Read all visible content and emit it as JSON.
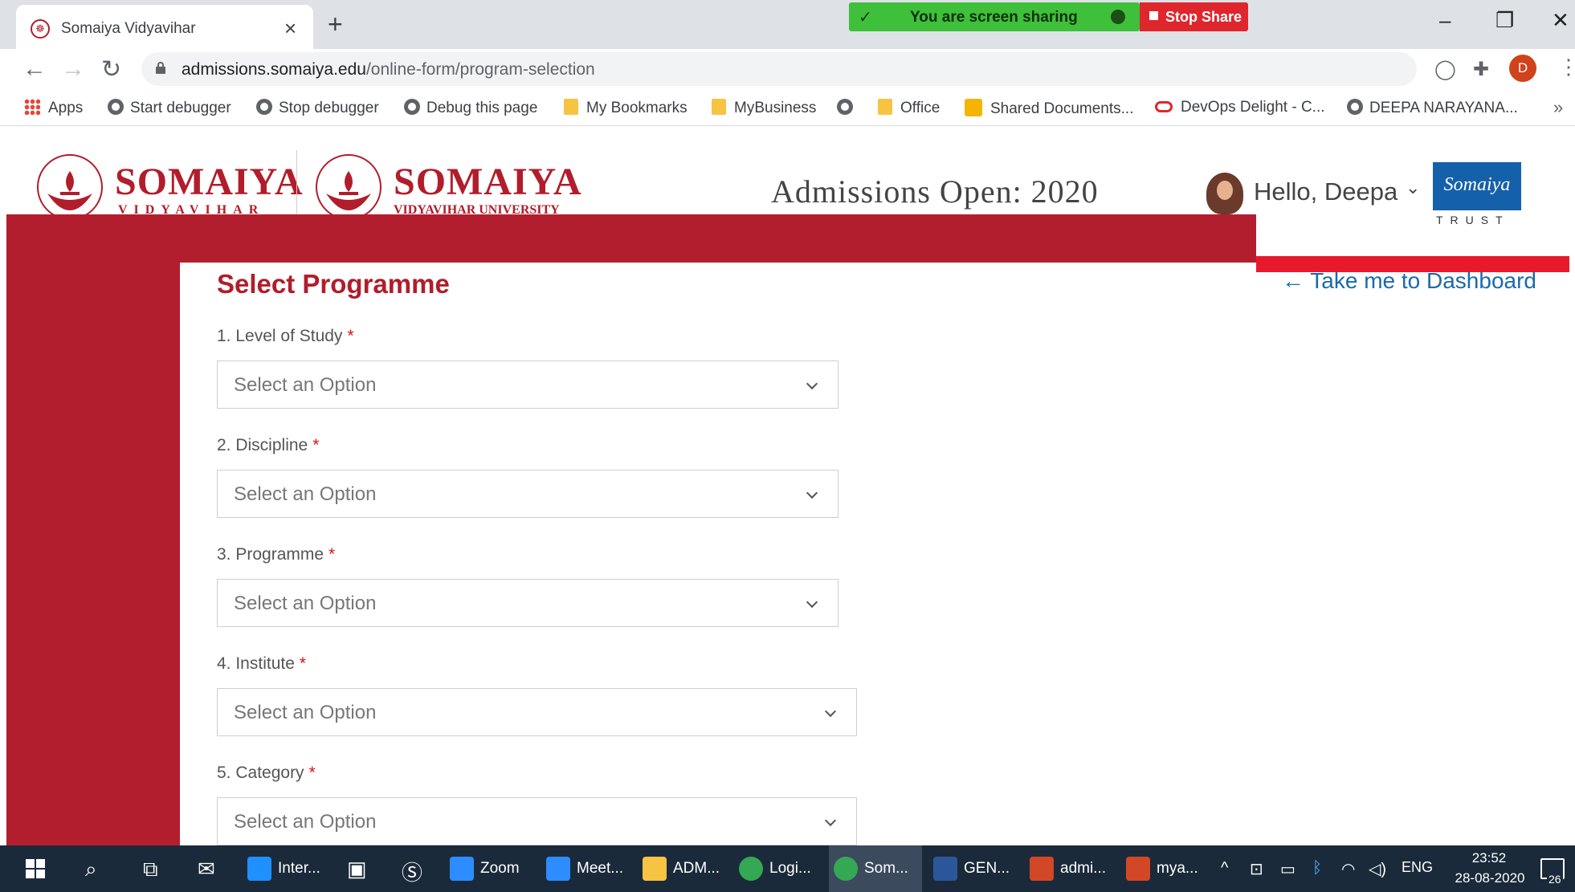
{
  "browser": {
    "tab_title": "Somaiya Vidyavihar",
    "url_host": "admissions.somaiya.edu",
    "url_path": "/online-form/program-selection",
    "profile_initial": "D",
    "screen_share_text": "You are screen sharing",
    "stop_share_label": "Stop Share",
    "bookmarks": [
      {
        "label": "Apps",
        "icon": "apps-grid-icon"
      },
      {
        "label": "Start debugger",
        "icon": "globe-icon"
      },
      {
        "label": "Stop debugger",
        "icon": "globe-icon"
      },
      {
        "label": "Debug this page",
        "icon": "globe-icon"
      },
      {
        "label": "My Bookmarks",
        "icon": "folder-icon"
      },
      {
        "label": "MyBusiness",
        "icon": "folder-icon"
      },
      {
        "label": "",
        "icon": "globe-icon"
      },
      {
        "label": "Office",
        "icon": "folder-icon"
      },
      {
        "label": "Shared Documents...",
        "icon": "sharepoint-icon"
      },
      {
        "label": "DevOps Delight - C...",
        "icon": "devops-icon"
      },
      {
        "label": "DEEPA NARAYANA...",
        "icon": "globe-icon"
      }
    ]
  },
  "header": {
    "logo1_word": "SOMAIYA",
    "logo1_sub": "VIDYAVIHAR",
    "logo2_word": "SOMAIYA",
    "logo2_sub": "VIDYAVIHAR UNIVERSITY",
    "admissions_text": "Admissions Open: 2020",
    "greeting": "Hello, Deepa",
    "trust_script": "Somaiya",
    "trust_text": "TRUST"
  },
  "main": {
    "title": "Select Programme",
    "dashboard_link": "← Take me to Dashboard",
    "required_mark": "*",
    "fields": [
      {
        "label": "1. Level of Study",
        "placeholder": "Select an Option"
      },
      {
        "label": "2. Discipline",
        "placeholder": "Select an Option"
      },
      {
        "label": "3. Programme",
        "placeholder": "Select an Option"
      },
      {
        "label": "4. Institute",
        "placeholder": "Select an Option"
      },
      {
        "label": "5. Category",
        "placeholder": "Select an Option"
      }
    ]
  },
  "taskbar": {
    "apps": [
      {
        "label": "Inter...",
        "icon": "internet-explorer-icon",
        "color": "#1e90ff"
      },
      {
        "label": "Zoom",
        "icon": "zoom-icon",
        "color": "#2d8cff"
      },
      {
        "label": "Meet...",
        "icon": "zoom-meeting-icon",
        "color": "#2d8cff"
      },
      {
        "label": "ADM...",
        "icon": "folder-icon",
        "color": "#f6c343"
      },
      {
        "label": "Logi...",
        "icon": "chrome-icon",
        "color": "#34a853"
      },
      {
        "label": "Som...",
        "icon": "chrome-icon",
        "color": "#34a853"
      },
      {
        "label": "GEN...",
        "icon": "word-icon",
        "color": "#2b579a"
      },
      {
        "label": "admi...",
        "icon": "powerpoint-icon",
        "color": "#d24726"
      },
      {
        "label": "mya...",
        "icon": "powerpoint-icon",
        "color": "#d24726"
      }
    ],
    "language": "ENG",
    "time": "23:52",
    "date": "28-08-2020",
    "notification_count": "26"
  }
}
